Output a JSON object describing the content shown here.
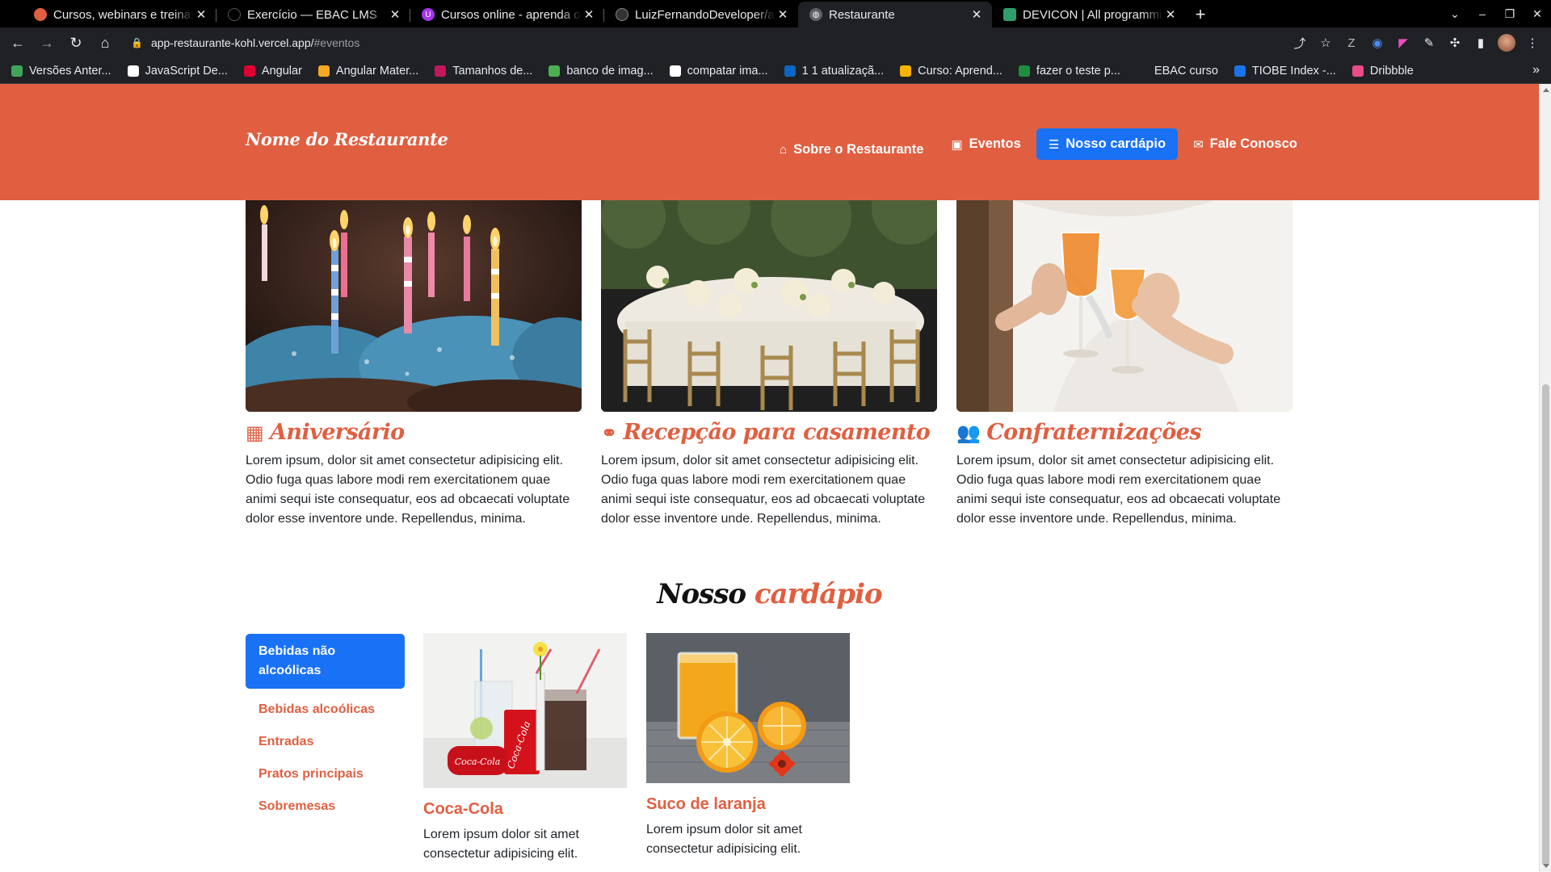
{
  "browser": {
    "tabs": [
      {
        "title": "Cursos, webinars e treinamentos",
        "fav": "#e05f41",
        "active": false
      },
      {
        "title": "Exercício — EBAC LMS",
        "fav": "#000",
        "active": false
      },
      {
        "title": "Cursos online - aprenda o que quiser",
        "fav": "#a435f0",
        "active": false
      },
      {
        "title": "LuizFernandoDeveloper/app-restaurante",
        "fav": "#333",
        "active": false
      },
      {
        "title": "Restaurante",
        "fav": "#5f6368",
        "active": true
      },
      {
        "title": "DEVICON | All programming languages",
        "fav": "#2e9e6b",
        "active": false
      }
    ],
    "url_host": "app-restaurante-kohl.vercel.app/",
    "url_path": "#eventos",
    "bookmarks": [
      {
        "label": "Versões Anter...",
        "color": "#3ea55a"
      },
      {
        "label": "JavaScript De...",
        "color": "#ffffff"
      },
      {
        "label": "Angular",
        "color": "#dd0031"
      },
      {
        "label": "Angular Mater...",
        "color": "#f5a623"
      },
      {
        "label": "Tamanhos de...",
        "color": "#c2185b"
      },
      {
        "label": "banco de imag...",
        "color": "#4caf50"
      },
      {
        "label": "compatar ima...",
        "color": "#ffffff"
      },
      {
        "label": "1 1 atualizaçã...",
        "color": "#0a66c2"
      },
      {
        "label": "Curso: Aprend...",
        "color": "#f4b400"
      },
      {
        "label": "fazer o teste p...",
        "color": "#1e8e3e"
      },
      {
        "label": "EBAC curso",
        "color": "#202124"
      },
      {
        "label": "TIOBE Index -...",
        "color": "#1a73e8"
      },
      {
        "label": "Dribbble",
        "color": "#ea4c89"
      }
    ],
    "bookmarks_more": "»"
  },
  "site": {
    "brand": "Nome do Restaurante",
    "nav": [
      {
        "label": "Sobre o Restaurante",
        "icon": "home-icon",
        "glyph": "⌂"
      },
      {
        "label": "Eventos",
        "icon": "calendar-icon",
        "glyph": "▣"
      },
      {
        "label": "Nosso cardápio",
        "icon": "menu-card-icon",
        "glyph": "☰"
      },
      {
        "label": "Fale Conosco",
        "icon": "chat-icon",
        "glyph": "✉"
      }
    ],
    "accent_color": "#e05f41",
    "active_color": "#1971f5"
  },
  "events": [
    {
      "title": "Aniversário",
      "icon": "calendar-icon",
      "glyph": "📅",
      "text": "Lorem ipsum, dolor sit amet consectetur adipisicing elit. Odio fuga quas labore modi rem exercitationem quae animi sequi iste consequatur, eos ad obcaecati voluptate dolor esse inventore unde. Repellendus, minima."
    },
    {
      "title": "Recepção para casamento",
      "icon": "rings-icon",
      "glyph": "⚭",
      "text": "Lorem ipsum, dolor sit amet consectetur adipisicing elit. Odio fuga quas labore modi rem exercitationem quae animi sequi iste consequatur, eos ad obcaecati voluptate dolor esse inventore unde. Repellendus, minima."
    },
    {
      "title": "Confraternizações",
      "icon": "users-icon",
      "glyph": "👥",
      "text": "Lorem ipsum, dolor sit amet consectetur adipisicing elit. Odio fuga quas labore modi rem exercitationem quae animi sequi iste consequatur, eos ad obcaecati voluptate dolor esse inventore unde. Repellendus, minima."
    }
  ],
  "menu_section": {
    "title_part1": "Nosso ",
    "title_part2": "cardápio",
    "categories": [
      {
        "label": "Bebidas não alcoólicas",
        "active": true
      },
      {
        "label": "Bebidas alcoólicas",
        "active": false
      },
      {
        "label": "Entradas",
        "active": false
      },
      {
        "label": "Pratos principais",
        "active": false
      },
      {
        "label": "Sobremesas",
        "active": false
      }
    ],
    "products": [
      {
        "name": "Coca-Cola",
        "text": "Lorem ipsum dolor sit amet consectetur adipisicing elit."
      },
      {
        "name": "Suco de laranja",
        "text": "Lorem ipsum dolor sit amet consectetur adipisicing elit."
      }
    ]
  }
}
